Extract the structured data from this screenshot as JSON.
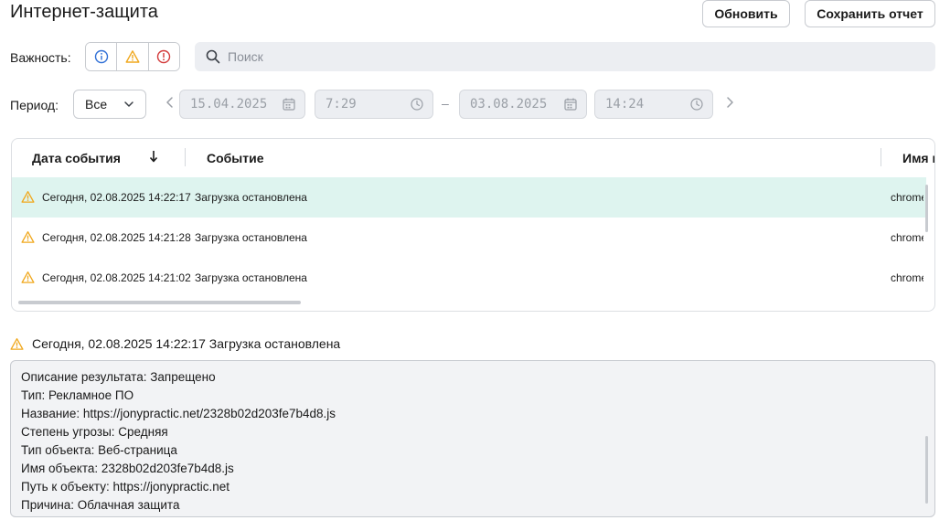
{
  "header": {
    "title": "Интернет-защита",
    "refresh_label": "Обновить",
    "save_report_label": "Сохранить отчет"
  },
  "filters": {
    "severity_label": "Важность:",
    "severity_buttons": [
      {
        "icon": "info-icon",
        "color": "#2f6fd6"
      },
      {
        "icon": "warning-icon",
        "color": "#f0a81e"
      },
      {
        "icon": "error-icon",
        "color": "#d33a3a"
      }
    ],
    "search_placeholder": "Поиск",
    "period_label": "Период:",
    "period_value": "Все",
    "date_from": "15.04.2025",
    "time_from": "7:29",
    "range_dash": "–",
    "date_to": "03.08.2025",
    "time_to": "14:24"
  },
  "table": {
    "columns": [
      "Дата события",
      "Событие",
      "Имя п"
    ],
    "rows": [
      {
        "date": "Сегодня, 02.08.2025 14:22:17",
        "event": "Загрузка остановлена",
        "process": "chrome",
        "selected": true
      },
      {
        "date": "Сегодня, 02.08.2025 14:21:28",
        "event": "Загрузка остановлена",
        "process": "chrome",
        "selected": false
      },
      {
        "date": "Сегодня, 02.08.2025 14:21:02",
        "event": "Загрузка остановлена",
        "process": "chrome",
        "selected": false
      }
    ]
  },
  "detail": {
    "title": "Сегодня, 02.08.2025 14:22:17 Загрузка остановлена",
    "lines": [
      "Описание результата: Запрещено",
      "Тип: Рекламное ПО",
      "Название: https://jonypractic.net/2328b02d203fe7b4d8.js",
      "Степень угрозы: Средняя",
      "Тип объекта: Веб-страница",
      "Имя объекта: 2328b02d203fe7b4d8.js",
      "Путь к объекту: https://jonypractic.net",
      "Причина: Облачная защита"
    ]
  },
  "colors": {
    "selected_row": "#def4ef",
    "warning": "#f0a81e"
  }
}
